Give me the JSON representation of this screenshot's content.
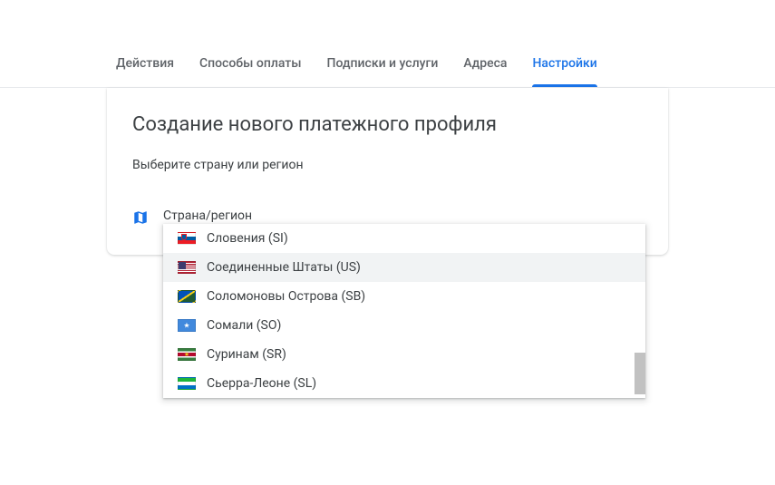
{
  "tabs": [
    {
      "label": "Действия",
      "active": false
    },
    {
      "label": "Способы оплаты",
      "active": false
    },
    {
      "label": "Подписки и услуги",
      "active": false
    },
    {
      "label": "Адреса",
      "active": false
    },
    {
      "label": "Настройки",
      "active": true
    }
  ],
  "card": {
    "title": "Создание нового платежного профиля",
    "subtitle": "Выберите страну или регион",
    "field_label": "Страна/регион"
  },
  "dropdown": {
    "options": [
      {
        "label": "Словения (SI)",
        "flag": "si",
        "highlighted": false
      },
      {
        "label": "Соединенные Штаты (US)",
        "flag": "us",
        "highlighted": true
      },
      {
        "label": "Соломоновы Острова (SB)",
        "flag": "sb",
        "highlighted": false
      },
      {
        "label": "Сомали (SO)",
        "flag": "so",
        "highlighted": false
      },
      {
        "label": "Суринам (SR)",
        "flag": "sr",
        "highlighted": false
      },
      {
        "label": "Сьерра-Леоне (SL)",
        "flag": "sl",
        "highlighted": false
      }
    ]
  }
}
